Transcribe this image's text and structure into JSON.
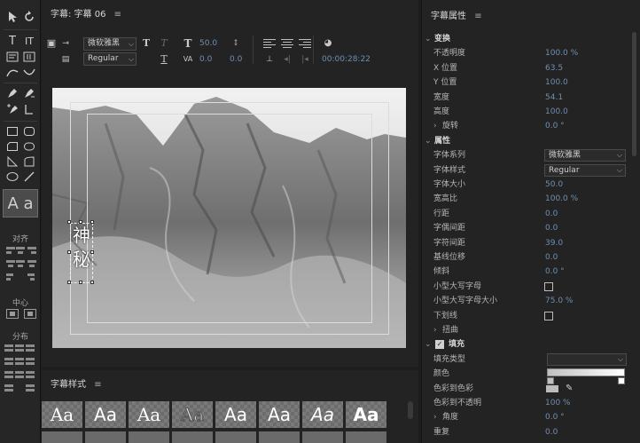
{
  "title_panel": {
    "title": "字幕: 字幕 06",
    "toolbar": {
      "font_family": "微软雅黑",
      "font_style": "Regular",
      "font_size": "50.0",
      "kerning": "0.0",
      "tracking": "0.0",
      "leading": "0.0",
      "timecode": "00:00:28:22"
    },
    "subtitle_text": [
      "神",
      "秘"
    ]
  },
  "tools_panel": {
    "aa_label": "A a",
    "align_label": "对齐",
    "center_label": "中心",
    "distribute_label": "分布"
  },
  "styles_panel": {
    "title": "字幕样式",
    "sample": "Aa"
  },
  "properties_panel": {
    "title": "字幕属性",
    "rows": [
      {
        "label": "变换",
        "type": "section"
      },
      {
        "label": "不透明度",
        "value": "100.0 %"
      },
      {
        "label": "X 位置",
        "value": "63.5"
      },
      {
        "label": "Y 位置",
        "value": "100.0"
      },
      {
        "label": "宽度",
        "value": "54.1"
      },
      {
        "label": "高度",
        "value": "100.0"
      },
      {
        "label": "旋转",
        "value": "0.0 °",
        "type": "sub"
      },
      {
        "label": "属性",
        "type": "section"
      },
      {
        "label": "字体系列",
        "value": "微软雅黑",
        "type": "dropdown"
      },
      {
        "label": "字体样式",
        "value": "Regular",
        "type": "dropdown"
      },
      {
        "label": "字体大小",
        "value": "50.0"
      },
      {
        "label": "宽高比",
        "value": "100.0 %"
      },
      {
        "label": "行距",
        "value": "0.0"
      },
      {
        "label": "字偶间距",
        "value": "0.0"
      },
      {
        "label": "字符间距",
        "value": "39.0"
      },
      {
        "label": "基线位移",
        "value": "0.0"
      },
      {
        "label": "倾斜",
        "value": "0.0 °"
      },
      {
        "label": "小型大写字母",
        "type": "checkbox"
      },
      {
        "label": "小型大写字母大小",
        "value": "75.0 %"
      },
      {
        "label": "下划线",
        "type": "checkbox"
      },
      {
        "label": "扭曲",
        "type": "sub"
      },
      {
        "label": "填充",
        "type": "section-check"
      },
      {
        "label": "填充类型",
        "type": "dropdown-empty"
      },
      {
        "label": "颜色",
        "type": "gradient"
      },
      {
        "label": "色彩到色彩",
        "type": "swatch"
      },
      {
        "label": "色彩到不透明",
        "value": "100 %"
      },
      {
        "label": "角度",
        "value": "0.0 °",
        "type": "sub"
      },
      {
        "label": "重复",
        "value": "0.0"
      }
    ]
  }
}
